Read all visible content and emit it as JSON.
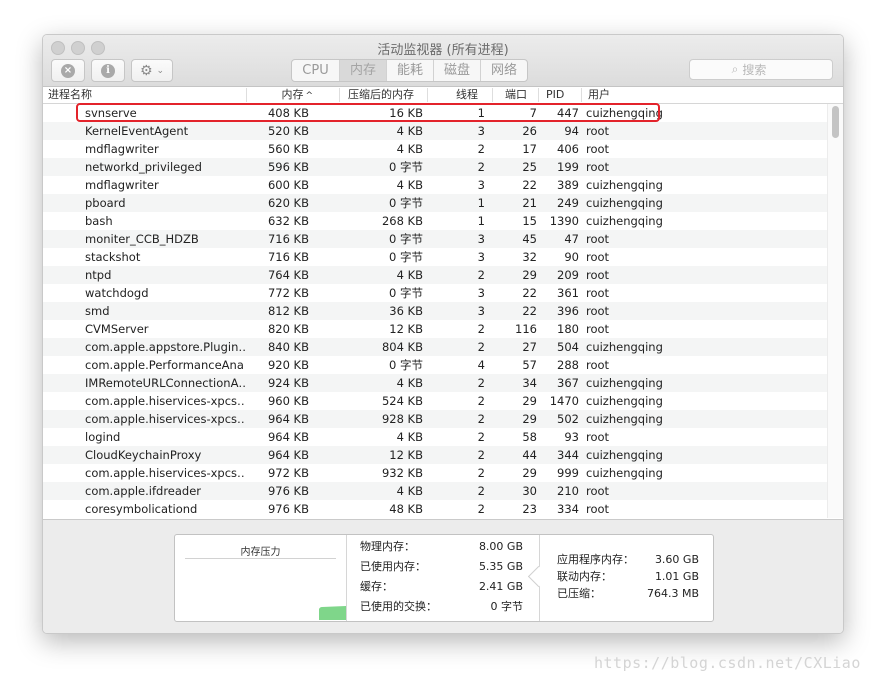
{
  "window": {
    "title": "活动监视器 (所有进程)"
  },
  "toolbar": {
    "stop_icon": "x-circle-icon",
    "stop_glyph": "×",
    "info_icon": "info-circle-icon",
    "info_glyph": "i",
    "gear_glyph": "⚙",
    "chevron_glyph": "⌄",
    "tabs": [
      {
        "label": "CPU",
        "active": false
      },
      {
        "label": "内存",
        "active": true
      },
      {
        "label": "能耗",
        "active": false
      },
      {
        "label": "磁盘",
        "active": false
      },
      {
        "label": "网络",
        "active": false
      }
    ],
    "search_glyph": "⌕",
    "search_placeholder": "搜索"
  },
  "table": {
    "columns": {
      "name": "进程名称",
      "memory": "内存",
      "sort_glyph": "^",
      "compressed": "压缩后的内存",
      "threads": "线程",
      "ports": "端口",
      "pid": "PID",
      "user": "用户"
    },
    "rows": [
      {
        "name": "svnserve",
        "memory": "408 KB",
        "compressed": "16 KB",
        "threads": "1",
        "ports": "7",
        "pid": "447",
        "user": "cuizhengqing"
      },
      {
        "name": "KernelEventAgent",
        "memory": "520 KB",
        "compressed": "4 KB",
        "threads": "3",
        "ports": "26",
        "pid": "94",
        "user": "root"
      },
      {
        "name": "mdflagwriter",
        "memory": "560 KB",
        "compressed": "4 KB",
        "threads": "2",
        "ports": "17",
        "pid": "406",
        "user": "root"
      },
      {
        "name": "networkd_privileged",
        "memory": "596 KB",
        "compressed": "0 字节",
        "threads": "2",
        "ports": "25",
        "pid": "199",
        "user": "root"
      },
      {
        "name": "mdflagwriter",
        "memory": "600 KB",
        "compressed": "4 KB",
        "threads": "3",
        "ports": "22",
        "pid": "389",
        "user": "cuizhengqing"
      },
      {
        "name": "pboard",
        "memory": "620 KB",
        "compressed": "0 字节",
        "threads": "1",
        "ports": "21",
        "pid": "249",
        "user": "cuizhengqing"
      },
      {
        "name": "bash",
        "memory": "632 KB",
        "compressed": "268 KB",
        "threads": "1",
        "ports": "15",
        "pid": "1390",
        "user": "cuizhengqing"
      },
      {
        "name": "moniter_CCB_HDZB",
        "memory": "716 KB",
        "compressed": "0 字节",
        "threads": "3",
        "ports": "45",
        "pid": "47",
        "user": "root"
      },
      {
        "name": "stackshot",
        "memory": "716 KB",
        "compressed": "0 字节",
        "threads": "3",
        "ports": "32",
        "pid": "90",
        "user": "root"
      },
      {
        "name": "ntpd",
        "memory": "764 KB",
        "compressed": "4 KB",
        "threads": "2",
        "ports": "29",
        "pid": "209",
        "user": "root"
      },
      {
        "name": "watchdogd",
        "memory": "772 KB",
        "compressed": "0 字节",
        "threads": "3",
        "ports": "22",
        "pid": "361",
        "user": "root"
      },
      {
        "name": "smd",
        "memory": "812 KB",
        "compressed": "36 KB",
        "threads": "3",
        "ports": "22",
        "pid": "396",
        "user": "root"
      },
      {
        "name": "CVMServer",
        "memory": "820 KB",
        "compressed": "12 KB",
        "threads": "2",
        "ports": "116",
        "pid": "180",
        "user": "root"
      },
      {
        "name": "com.apple.appstore.Plugin…",
        "memory": "840 KB",
        "compressed": "804 KB",
        "threads": "2",
        "ports": "27",
        "pid": "504",
        "user": "cuizhengqing"
      },
      {
        "name": "com.apple.PerformanceAna…",
        "memory": "920 KB",
        "compressed": "0 字节",
        "threads": "4",
        "ports": "57",
        "pid": "288",
        "user": "root"
      },
      {
        "name": "IMRemoteURLConnectionA…",
        "memory": "924 KB",
        "compressed": "4 KB",
        "threads": "2",
        "ports": "34",
        "pid": "367",
        "user": "cuizhengqing"
      },
      {
        "name": "com.apple.hiservices-xpcs…",
        "memory": "960 KB",
        "compressed": "524 KB",
        "threads": "2",
        "ports": "29",
        "pid": "1470",
        "user": "cuizhengqing"
      },
      {
        "name": "com.apple.hiservices-xpcs…",
        "memory": "964 KB",
        "compressed": "928 KB",
        "threads": "2",
        "ports": "29",
        "pid": "502",
        "user": "cuizhengqing"
      },
      {
        "name": "logind",
        "memory": "964 KB",
        "compressed": "4 KB",
        "threads": "2",
        "ports": "58",
        "pid": "93",
        "user": "root"
      },
      {
        "name": "CloudKeychainProxy",
        "memory": "964 KB",
        "compressed": "12 KB",
        "threads": "2",
        "ports": "44",
        "pid": "344",
        "user": "cuizhengqing"
      },
      {
        "name": "com.apple.hiservices-xpcs…",
        "memory": "972 KB",
        "compressed": "932 KB",
        "threads": "2",
        "ports": "29",
        "pid": "999",
        "user": "cuizhengqing"
      },
      {
        "name": "com.apple.ifdreader",
        "memory": "976 KB",
        "compressed": "4 KB",
        "threads": "2",
        "ports": "30",
        "pid": "210",
        "user": "root"
      },
      {
        "name": "coresymbolicationd",
        "memory": "976 KB",
        "compressed": "48 KB",
        "threads": "2",
        "ports": "23",
        "pid": "334",
        "user": "root"
      }
    ]
  },
  "summary": {
    "pressure_label": "内存压力",
    "pressure_color": "#7fd68a",
    "left_stats": [
      {
        "label": "物理内存：",
        "value": "8.00 GB"
      },
      {
        "label": "已使用内存：",
        "value": "5.35 GB"
      },
      {
        "label": "缓存：",
        "value": "2.41 GB"
      },
      {
        "label": "已使用的交换：",
        "value": "0 字节"
      }
    ],
    "right_stats": [
      {
        "label": "应用程序内存：",
        "value": "3.60 GB"
      },
      {
        "label": "联动内存：",
        "value": "1.01 GB"
      },
      {
        "label": "已压缩：",
        "value": "764.3 MB"
      }
    ]
  },
  "watermark": "https://blog.csdn.net/CXLiao",
  "highlight_color": "#e3232b"
}
